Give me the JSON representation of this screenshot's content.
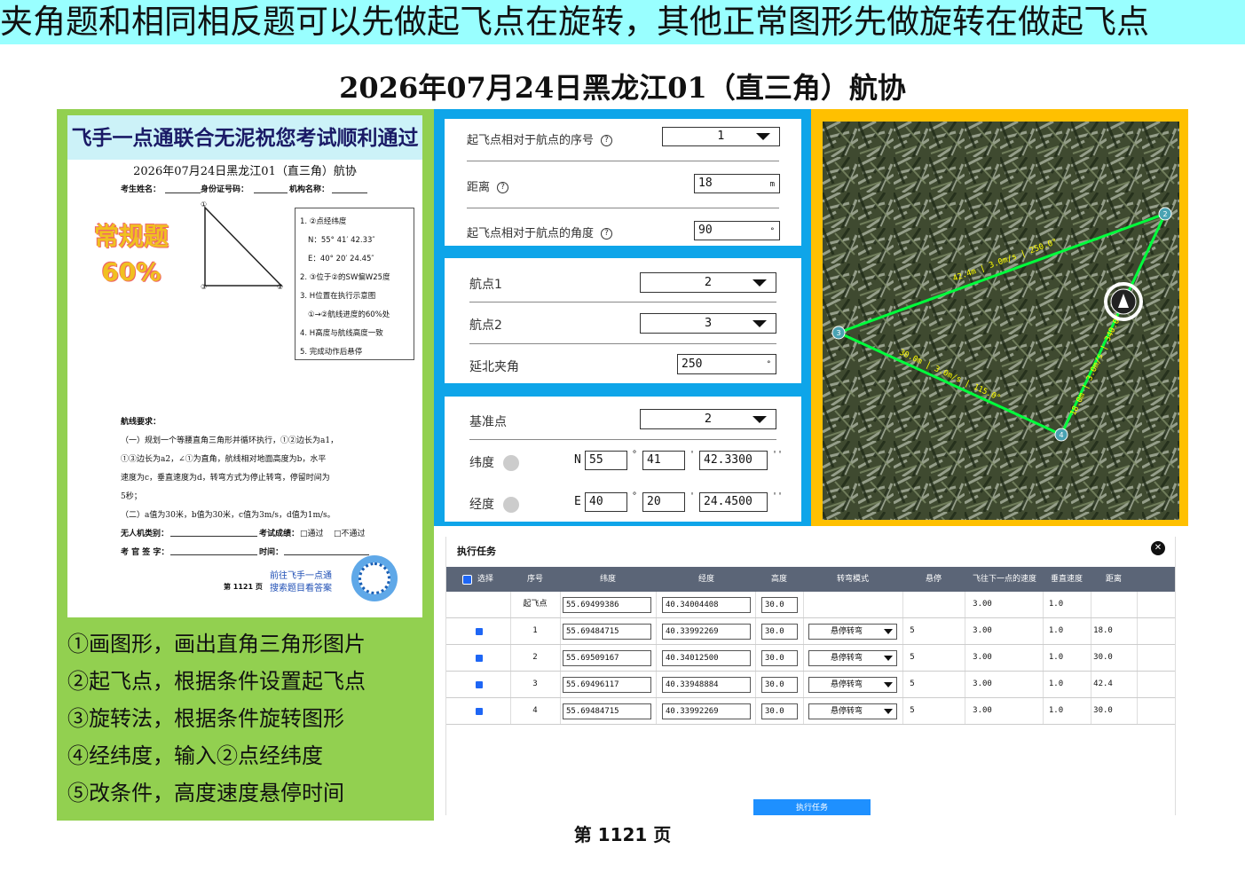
{
  "banner": "夹角题和相同相反题可以先做起飞点在旋转，其他正常图形先做旋转在做起飞点",
  "title": "2026年07月24日黑龙江01（直三角）航协",
  "paper": {
    "header": "飞手一点通联合无泥祝您考试顺利通过",
    "title": "2026年07月24日黑龙江01（直三角）航协",
    "fields": [
      "考生姓名：",
      "身份证号码：",
      "机构名称："
    ],
    "stamp_line1": "常规题",
    "stamp_line2": "60%",
    "point_labels": [
      "①",
      "②",
      "③"
    ],
    "conditions": [
      "1. ②点经纬度",
      "N：55° 41′ 42.33″",
      "E：40° 20′ 24.45″",
      "2. ③位于②的SW偏W25度",
      "3. H位置在执行示意图",
      "①→②航线进度的60%处",
      "4. H高度与航线高度一致",
      "5. 完成动作后悬停"
    ],
    "requirements_title": "航线要求：",
    "requirements": [
      "（一）规划一个等腰直角三角形并循环执行，①②边长为a1，",
      "①③边长为a2，∠①为直角，航线相对地面高度为b，水平",
      "速度为c，垂直速度为d，转弯方式为停止转弯，停留时间为",
      "5秒；",
      "（二）a值为30米，b值为30米，c值为3m/s，d值为1m/s。"
    ],
    "uav_type": "无人机类别：",
    "result": "考试成绩：",
    "pass": "□通过",
    "fail": "□不通过",
    "examiner": "考 官 签 字：",
    "time": "时间：",
    "promo_line1": "前往飞手一点通",
    "promo_line2": "搜索题目看答案",
    "page": "第 1121 页"
  },
  "steps": [
    "①画图形，画出直角三角形图片",
    "②起飞点，根据条件设置起飞点",
    "③旋转法，根据条件旋转图形",
    "④经纬度，输入②点经纬度",
    "⑤改条件，高度速度悬停时间"
  ],
  "takeoff": {
    "index_label": "起飞点相对于航点的序号",
    "index_value": "1",
    "distance_label": "距离",
    "distance_value": "18",
    "distance_unit": "m",
    "angle_label": "起飞点相对于航点的角度",
    "angle_value": "90",
    "deg": "°"
  },
  "rotate": {
    "wp1_label": "航点1",
    "wp1_value": "2",
    "wp2_label": "航点2",
    "wp2_value": "3",
    "angle_label": "延北夹角",
    "angle_value": "250",
    "deg": "°"
  },
  "coords": {
    "base_label": "基准点",
    "base_value": "2",
    "lat_label": "纬度",
    "lat_hemi": "N",
    "lat_deg": "55",
    "lat_min": "41",
    "lat_sec": "42.3300",
    "lon_label": "经度",
    "lon_hemi": "E",
    "lon_deg": "40",
    "lon_min": "20",
    "lon_sec": "24.4500",
    "deg_sym": "°",
    "min_sym": "'",
    "sec_sym": "''"
  },
  "map": {
    "labels": [
      "42.4m | 3.0m/s | 250.0°",
      "30.0m | 3.0m/s | 115.0°",
      "18.0m | 3.0m/s | 340.0°"
    ],
    "points": [
      "2",
      "3",
      "4"
    ]
  },
  "task": {
    "title": "执行任务",
    "headers": [
      "选择",
      "序号",
      "纬度",
      "经度",
      "高度",
      "转弯模式",
      "悬停",
      "飞往下一点的速度",
      "垂直速度",
      "距离"
    ],
    "rows": [
      {
        "seq": "起飞点",
        "lat": "55.69499386",
        "lon": "40.34004408",
        "alt": "30.0",
        "mode": "",
        "hover": "",
        "speed": "3.00",
        "vspeed": "1.0",
        "dist": ""
      },
      {
        "seq": "1",
        "lat": "55.69484715",
        "lon": "40.33992269",
        "alt": "30.0",
        "mode": "悬停转弯",
        "hover": "5",
        "speed": "3.00",
        "vspeed": "1.0",
        "dist": "18.0"
      },
      {
        "seq": "2",
        "lat": "55.69509167",
        "lon": "40.34012500",
        "alt": "30.0",
        "mode": "悬停转弯",
        "hover": "5",
        "speed": "3.00",
        "vspeed": "1.0",
        "dist": "30.0"
      },
      {
        "seq": "3",
        "lat": "55.69496117",
        "lon": "40.33948884",
        "alt": "30.0",
        "mode": "悬停转弯",
        "hover": "5",
        "speed": "3.00",
        "vspeed": "1.0",
        "dist": "42.4"
      },
      {
        "seq": "4",
        "lat": "55.69484715",
        "lon": "40.33992269",
        "alt": "30.0",
        "mode": "悬停转弯",
        "hover": "5",
        "speed": "3.00",
        "vspeed": "1.0",
        "dist": "30.0"
      }
    ],
    "exec_button": "执行任务"
  },
  "page_number": "第 1121 页"
}
